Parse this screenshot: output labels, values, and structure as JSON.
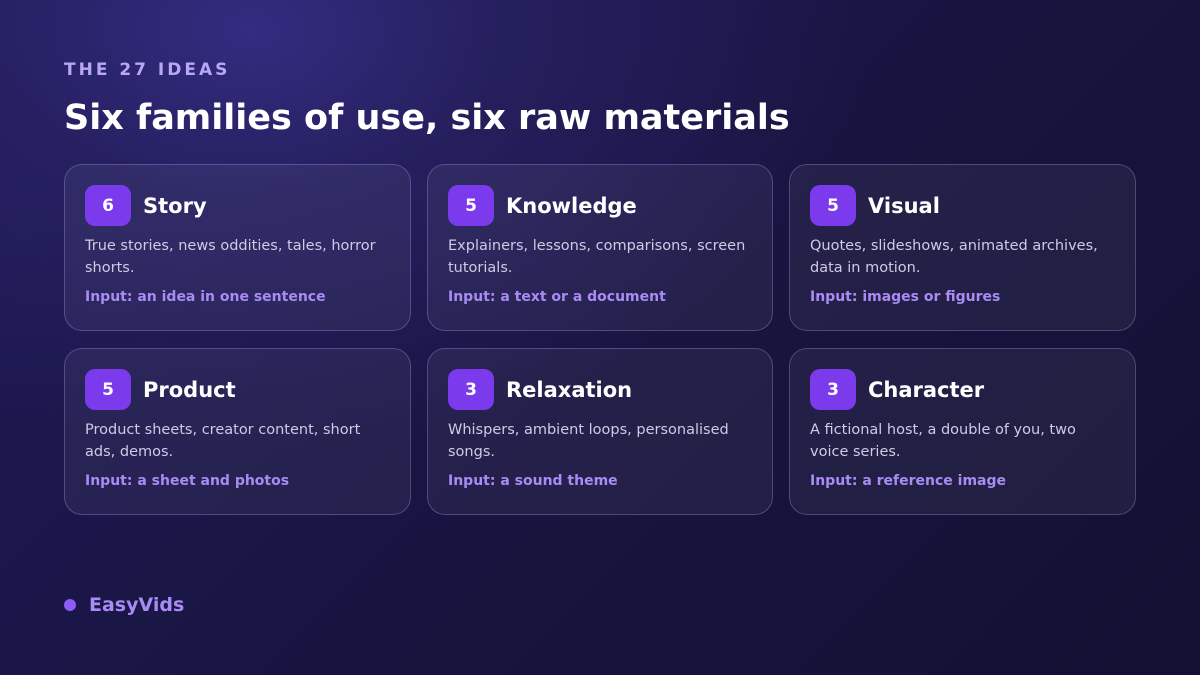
{
  "header": {
    "eyebrow": "THE 27 IDEAS",
    "title": "Six families of use, six raw materials"
  },
  "cards": [
    {
      "count": "6",
      "title": "Story",
      "desc": "True stories, news oddities, tales, horror shorts.",
      "input": "Input: an idea in one sentence"
    },
    {
      "count": "5",
      "title": "Knowledge",
      "desc": "Explainers, lessons, comparisons, screen tutorials.",
      "input": "Input: a text or a document"
    },
    {
      "count": "5",
      "title": "Visual",
      "desc": "Quotes, slideshows, animated archives, data in motion.",
      "input": "Input: images or figures"
    },
    {
      "count": "5",
      "title": "Product",
      "desc": "Product sheets, creator content, short ads, demos.",
      "input": "Input: a sheet and photos"
    },
    {
      "count": "3",
      "title": "Relaxation",
      "desc": "Whispers, ambient loops, personalised songs.",
      "input": "Input: a sound theme"
    },
    {
      "count": "3",
      "title": "Character",
      "desc": "A fictional host, a double of you, two voice series.",
      "input": "Input: a reference image"
    }
  ],
  "footer": {
    "brand": "EasyVids"
  },
  "colors": {
    "accent": "#7c3aed",
    "accent_text": "#a98bf5",
    "background": "#1a1640"
  }
}
